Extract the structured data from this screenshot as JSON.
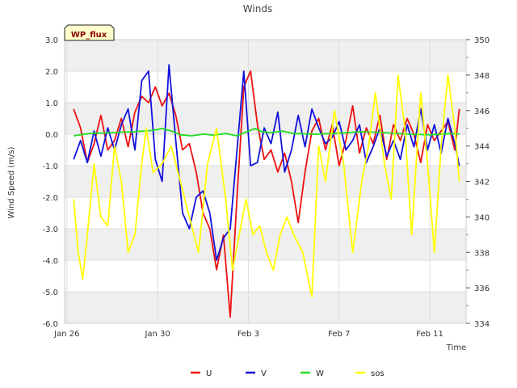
{
  "chart_data": {
    "type": "line",
    "title": "Winds",
    "badge": "WP_flux",
    "xlabel": "Time",
    "ylabel": "Wind Speed (m/s)",
    "y2label": "",
    "xlim": [
      -0.1,
      17.6
    ],
    "ylim": [
      -6.0,
      3.0
    ],
    "y2lim": [
      334,
      350
    ],
    "x_ticks": [
      {
        "value": 0,
        "label": "Jan 26"
      },
      {
        "value": 4,
        "label": "Jan 30"
      },
      {
        "value": 8,
        "label": "Feb 3"
      },
      {
        "value": 12,
        "label": "Feb 7"
      },
      {
        "value": 16,
        "label": "Feb 11"
      }
    ],
    "y_ticks": [
      {
        "value": 3,
        "label": "3.0"
      },
      {
        "value": 2,
        "label": "2.0"
      },
      {
        "value": 1,
        "label": "1.0"
      },
      {
        "value": 0,
        "label": "0.0"
      },
      {
        "value": -1,
        "label": "-1.0"
      },
      {
        "value": -2,
        "label": "-2.0"
      },
      {
        "value": -3,
        "label": "-3.0"
      },
      {
        "value": -4,
        "label": "-4.0"
      },
      {
        "value": -5,
        "label": "-5.0"
      },
      {
        "value": -6,
        "label": "-6.0"
      }
    ],
    "y2_ticks": [
      {
        "value": 350,
        "label": "350"
      },
      {
        "value": 348,
        "label": "348"
      },
      {
        "value": 346,
        "label": "346"
      },
      {
        "value": 344,
        "label": "344"
      },
      {
        "value": 342,
        "label": "342"
      },
      {
        "value": 340,
        "label": "340"
      },
      {
        "value": 338,
        "label": "338"
      },
      {
        "value": 336,
        "label": "336"
      },
      {
        "value": 334,
        "label": "334"
      }
    ],
    "bands": [
      [
        2,
        3
      ],
      [
        0,
        1
      ],
      [
        -2,
        -1
      ],
      [
        -4,
        -3
      ],
      [
        -6,
        -5
      ]
    ],
    "grid": true,
    "legend_position": "bottom",
    "series": [
      {
        "name": "U",
        "color": "#ee1111",
        "axis": "left",
        "x": [
          0.3,
          0.6,
          0.9,
          1.2,
          1.5,
          1.8,
          2.1,
          2.4,
          2.7,
          3.0,
          3.3,
          3.6,
          3.9,
          4.2,
          4.5,
          4.8,
          5.1,
          5.4,
          5.7,
          6.0,
          6.3,
          6.6,
          6.9,
          7.2,
          7.5,
          7.8,
          8.1,
          8.4,
          8.7,
          9.0,
          9.3,
          9.6,
          9.9,
          10.2,
          10.5,
          10.8,
          11.1,
          11.4,
          11.7,
          12.0,
          12.3,
          12.6,
          12.9,
          13.2,
          13.5,
          13.8,
          14.1,
          14.4,
          14.7,
          15.0,
          15.3,
          15.6,
          15.9,
          16.2,
          16.5,
          16.8,
          17.1,
          17.3
        ],
        "y": [
          0.8,
          0.2,
          -0.9,
          -0.3,
          0.6,
          -0.5,
          -0.2,
          0.5,
          -0.4,
          0.7,
          1.2,
          1.0,
          1.5,
          0.9,
          1.3,
          0.6,
          -0.5,
          -0.3,
          -1.2,
          -2.5,
          -3.0,
          -4.3,
          -3.2,
          -5.8,
          -2.0,
          1.5,
          2.0,
          0.3,
          -0.8,
          -0.5,
          -1.2,
          -0.6,
          -1.5,
          -2.8,
          -1.2,
          0.1,
          0.5,
          -0.5,
          0.3,
          -1.0,
          -0.2,
          0.9,
          -0.6,
          0.2,
          -0.3,
          0.6,
          -0.8,
          0.3,
          -0.2,
          0.5,
          0.0,
          -0.9,
          0.3,
          -0.2,
          0.1,
          0.4,
          -0.5,
          0.8
        ]
      },
      {
        "name": "V",
        "color": "#1111dd",
        "axis": "left",
        "x": [
          0.3,
          0.6,
          0.9,
          1.2,
          1.5,
          1.8,
          2.1,
          2.4,
          2.7,
          3.0,
          3.3,
          3.6,
          3.9,
          4.2,
          4.5,
          4.8,
          5.1,
          5.4,
          5.7,
          6.0,
          6.3,
          6.6,
          6.9,
          7.2,
          7.5,
          7.8,
          8.1,
          8.4,
          8.7,
          9.0,
          9.3,
          9.6,
          9.9,
          10.2,
          10.5,
          10.8,
          11.1,
          11.4,
          11.7,
          12.0,
          12.3,
          12.6,
          12.9,
          13.2,
          13.5,
          13.8,
          14.1,
          14.4,
          14.7,
          15.0,
          15.3,
          15.6,
          15.9,
          16.2,
          16.5,
          16.8,
          17.1,
          17.3
        ],
        "y": [
          -0.8,
          -0.2,
          -0.9,
          0.1,
          -0.7,
          0.2,
          -0.5,
          0.3,
          0.8,
          -0.5,
          1.7,
          2.0,
          -0.8,
          -1.5,
          2.2,
          -0.2,
          -2.5,
          -3.0,
          -2.0,
          -1.8,
          -2.5,
          -4.0,
          -3.3,
          -3.0,
          -0.5,
          2.0,
          -1.0,
          -0.9,
          0.2,
          -0.3,
          0.7,
          -1.2,
          -0.5,
          0.6,
          -0.4,
          0.8,
          0.2,
          -0.3,
          -0.1,
          0.4,
          -0.5,
          -0.2,
          0.3,
          -0.9,
          -0.4,
          0.2,
          -0.7,
          -0.2,
          -0.8,
          0.3,
          -0.4,
          0.8,
          -0.5,
          0.3,
          -0.6,
          0.5,
          -0.3,
          -1.0
        ]
      },
      {
        "name": "W",
        "color": "#22dd22",
        "axis": "left",
        "x": [
          0.3,
          1.0,
          2.0,
          3.0,
          3.8,
          4.2,
          4.6,
          5.0,
          5.5,
          6.0,
          6.5,
          7.0,
          7.5,
          8.0,
          8.3,
          8.6,
          9.0,
          9.5,
          10.0,
          11.0,
          12.0,
          13.0,
          14.0,
          15.0,
          16.0,
          17.0,
          17.3
        ],
        "y": [
          -0.05,
          0.02,
          0.05,
          0.08,
          0.12,
          0.18,
          0.1,
          -0.02,
          -0.05,
          0.0,
          -0.03,
          0.02,
          -0.05,
          0.1,
          0.18,
          0.08,
          0.05,
          0.1,
          0.02,
          0.0,
          0.03,
          0.08,
          0.05,
          0.0,
          -0.02,
          0.02,
          0.0
        ]
      },
      {
        "name": "sos",
        "color": "#ffff00",
        "axis": "right",
        "x": [
          0.3,
          0.5,
          0.7,
          0.9,
          1.2,
          1.5,
          1.8,
          2.1,
          2.4,
          2.7,
          3.0,
          3.3,
          3.5,
          3.8,
          4.2,
          4.6,
          5.0,
          5.4,
          5.8,
          6.2,
          6.6,
          7.0,
          7.3,
          7.6,
          7.9,
          8.2,
          8.5,
          8.8,
          9.1,
          9.4,
          9.7,
          10.0,
          10.4,
          10.8,
          11.1,
          11.4,
          11.8,
          12.2,
          12.6,
          13.0,
          13.3,
          13.6,
          14.0,
          14.3,
          14.6,
          14.9,
          15.2,
          15.6,
          15.9,
          16.2,
          16.5,
          16.8,
          17.1,
          17.3
        ],
        "y": [
          341,
          338,
          336.5,
          339,
          343,
          340,
          339.5,
          344,
          342,
          338,
          339,
          343,
          345,
          342.5,
          343,
          344,
          342,
          340,
          338,
          343,
          345,
          341,
          337,
          339,
          341,
          339,
          339.5,
          338,
          337,
          339,
          340,
          339,
          338,
          335.5,
          344,
          342,
          346,
          343,
          338,
          342,
          344,
          347,
          343,
          341,
          348,
          345,
          339,
          347,
          343,
          338,
          344,
          348,
          345,
          342
        ]
      }
    ]
  }
}
